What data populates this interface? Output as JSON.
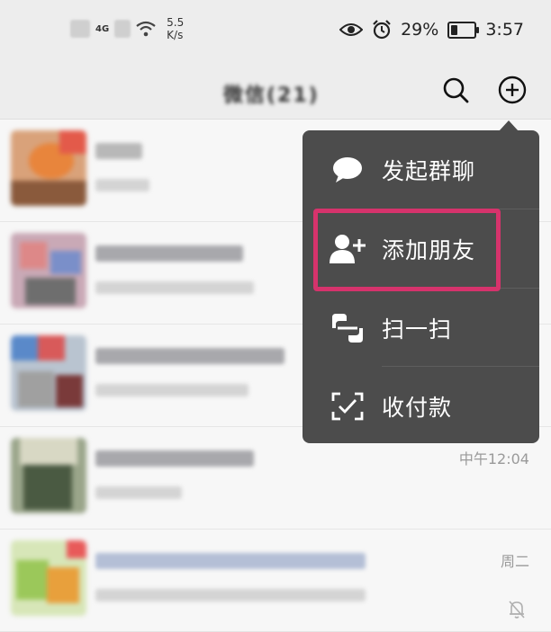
{
  "status_bar": {
    "network": "4G",
    "speed_value": "5.5",
    "speed_unit": "K/s",
    "battery": "29%",
    "battery_level": 0.29,
    "time": "3:57",
    "icons": [
      "signal-icon",
      "wifi-icon",
      "eye-icon",
      "alarm-icon",
      "battery-icon"
    ]
  },
  "header": {
    "title": "微信(21)",
    "icons": [
      "search-icon",
      "plus-circle-icon"
    ]
  },
  "chats": [
    {
      "time": ""
    },
    {
      "time": ""
    },
    {
      "time": ""
    },
    {
      "time": "中午12:04"
    },
    {
      "time": "周二",
      "muted": true
    }
  ],
  "popup_menu": {
    "items": [
      {
        "label": "发起群聊",
        "icon": "chat-bubble-icon"
      },
      {
        "label": "添加朋友",
        "icon": "add-friend-icon",
        "highlighted": true
      },
      {
        "label": "扫一扫",
        "icon": "scan-icon"
      },
      {
        "label": "收付款",
        "icon": "payment-icon"
      }
    ],
    "highlight_color": "#d6336c",
    "background": "#4c4c4c"
  }
}
